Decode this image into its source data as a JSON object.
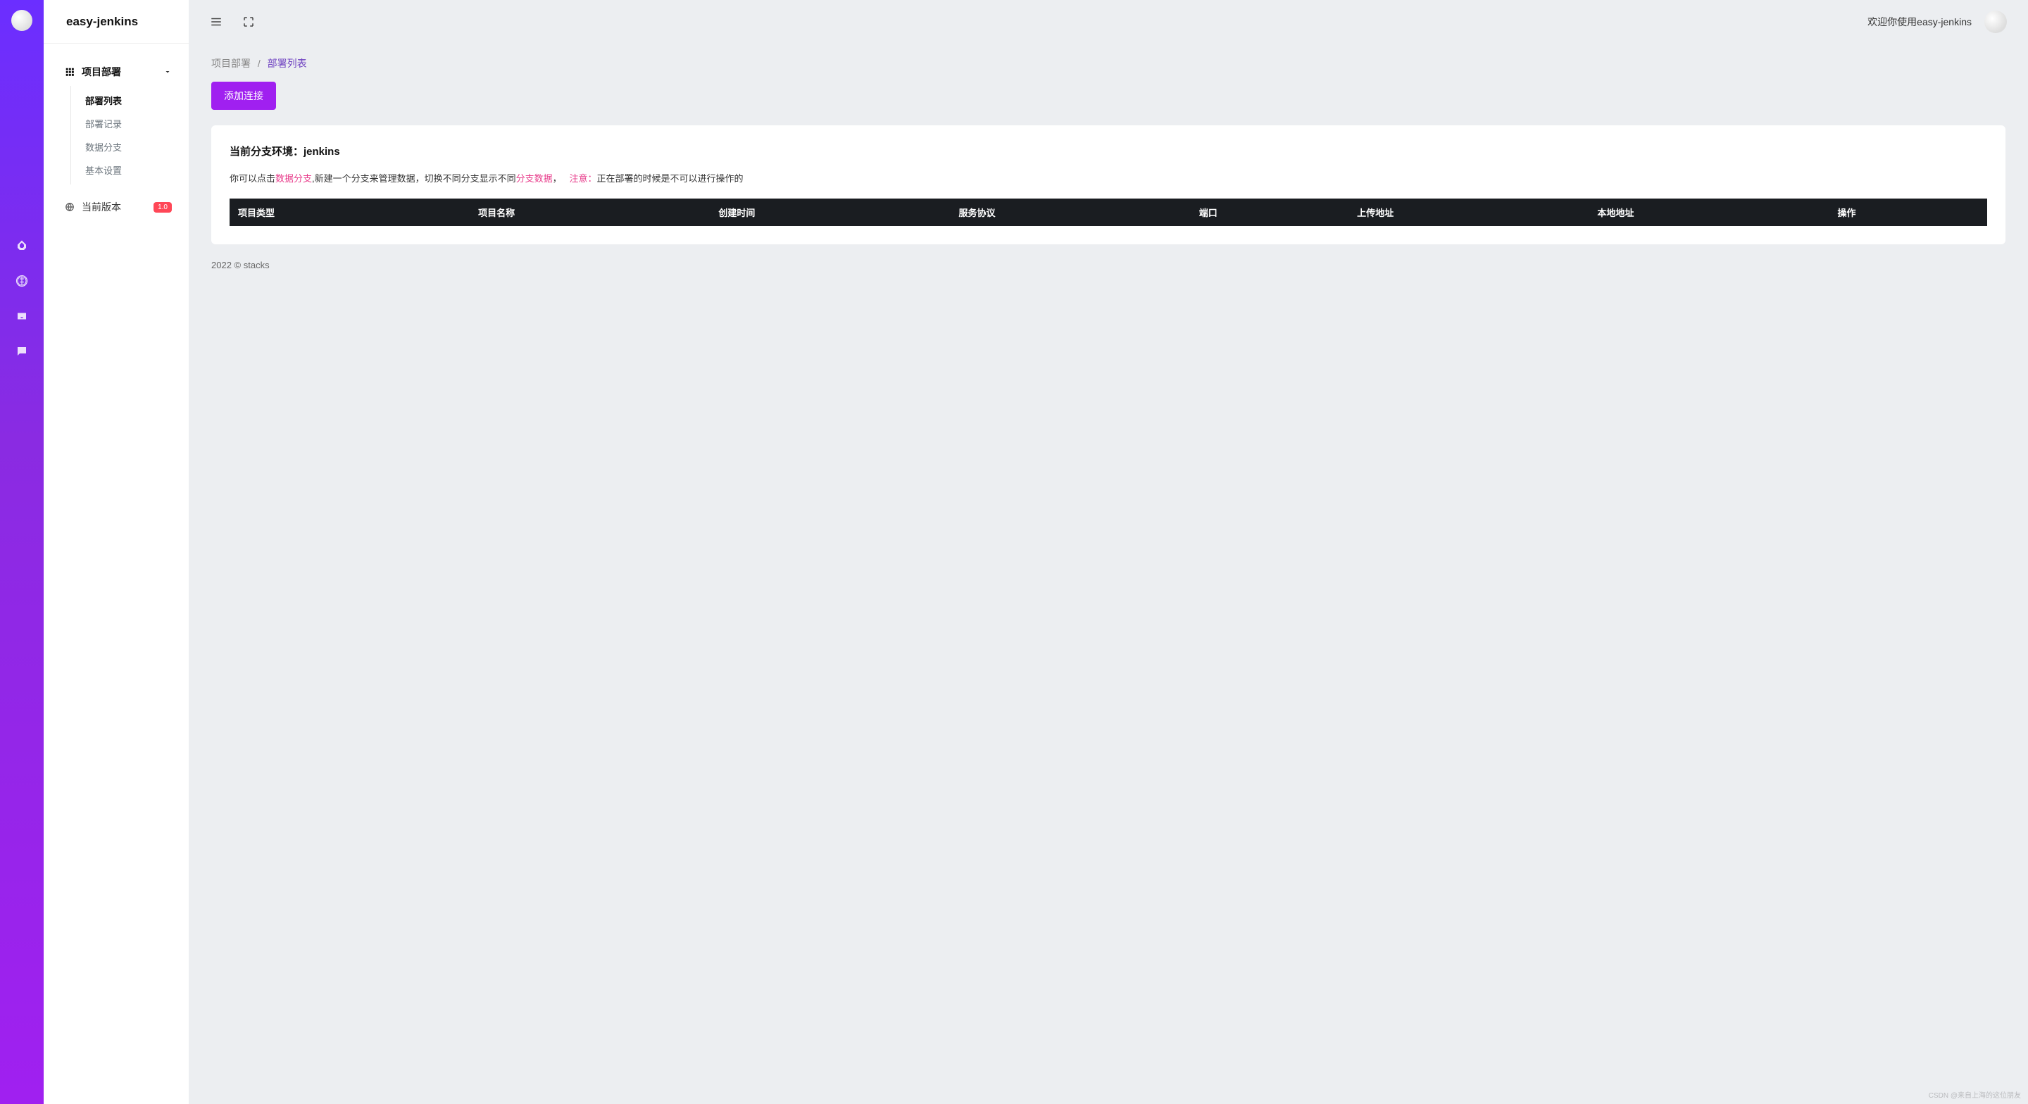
{
  "app": {
    "name": "easy-jenkins"
  },
  "sidebar": {
    "parent": {
      "label": "项目部署"
    },
    "items": [
      {
        "label": "部署列表",
        "active": true
      },
      {
        "label": "部署记录",
        "active": false
      },
      {
        "label": "数据分支",
        "active": false
      },
      {
        "label": "基本设置",
        "active": false
      }
    ],
    "version": {
      "label": "当前版本",
      "badge": "1.0"
    }
  },
  "topbar": {
    "welcome": "欢迎你使用easy-jenkins"
  },
  "breadcrumb": {
    "parent": "项目部署",
    "separator": "/",
    "current": "部署列表"
  },
  "actions": {
    "add": "添加连接"
  },
  "card": {
    "title": "当前分支环境：jenkins",
    "desc_part1": "你可以点击",
    "desc_link1": "数据分支",
    "desc_part2": ",新建一个分支来管理数据，切换不同分支显示不同",
    "desc_link2": "分支数据",
    "desc_part3": "，",
    "desc_warn_label": "注意：",
    "desc_warn_text": "正在部署的时候是不可以进行操作的"
  },
  "table": {
    "headers": [
      "项目类型",
      "项目名称",
      "创建时间",
      "服务协议",
      "端口",
      "上传地址",
      "本地地址",
      "操作"
    ],
    "rows": []
  },
  "footer": {
    "text": "2022 © stacks"
  },
  "watermark": "CSDN @来自上海的这位朋友"
}
